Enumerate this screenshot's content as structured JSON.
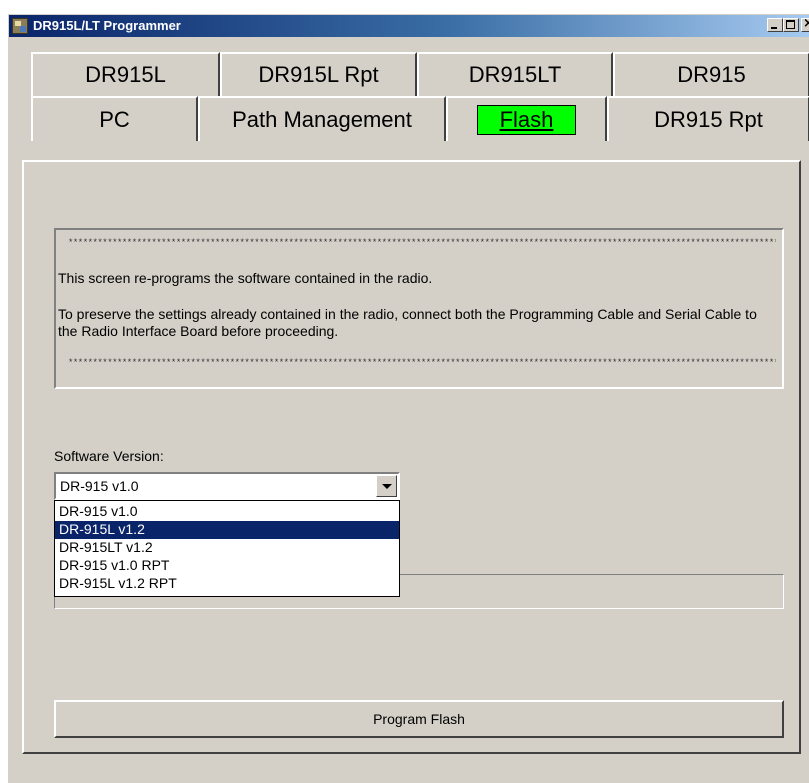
{
  "window": {
    "title": "DR915L/LT Programmer",
    "app_icon": "programmer-app-icon",
    "controls": {
      "minimize": "minimize-icon",
      "maximize": "maximize-icon",
      "close": "×"
    }
  },
  "tabs": {
    "row1": [
      "DR915L",
      "DR915L Rpt",
      "DR915LT",
      "DR915"
    ],
    "row2": [
      "PC",
      "Path Management",
      "Flash",
      "DR915 Rpt"
    ],
    "active": "Flash",
    "active_color": "#00ff00"
  },
  "info": {
    "stars": "*******************************************************************************************************************************************************************************************************************",
    "line1": "This screen re-programs the software contained in the radio.",
    "line2": "To preserve the settings already contained in the radio, connect both the Programming Cable and Serial Cable to the Radio Interface Board before proceeding."
  },
  "software": {
    "label": "Software Version:",
    "selected_value": "DR-915 v1.0",
    "options": [
      "DR-915 v1.0",
      "DR-915L v1.2",
      "DR-915LT v1.2",
      "DR-915 v1.0 RPT",
      "DR-915L v1.2 RPT"
    ],
    "highlighted_option": "DR-915L v1.2",
    "highlight_color": "#0a246a"
  },
  "progress": {
    "value": 0
  },
  "program_button": {
    "label": "Program Flash"
  }
}
